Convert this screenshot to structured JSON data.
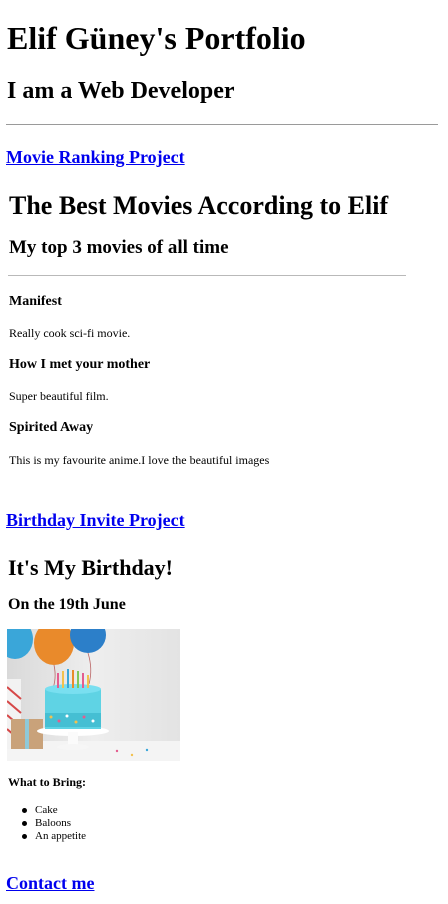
{
  "header": {
    "title": "Elif Güney's Portfolio",
    "subtitle": "I am a Web Developer"
  },
  "movie_section": {
    "link_text": "Movie Ranking Project",
    "title": "The Best Movies According to Elif",
    "subtitle": "My top 3 movies of all time",
    "movies": [
      {
        "name": "Manifest",
        "description": "Really cook sci-fi movie."
      },
      {
        "name": "How I met your mother",
        "description": "Super beautiful film."
      },
      {
        "name": "Spirited Away",
        "description": "This is my favourite anime.I love the beautiful images"
      }
    ]
  },
  "birthday_section": {
    "link_text": "Birthday Invite Project",
    "title": "It's My Birthday!",
    "date": "On the 19th June",
    "image": "birthday-cake-with-balloons",
    "bring_title": "What to Bring:",
    "bring_items": [
      "Cake",
      "Baloons",
      "An appetite"
    ]
  },
  "contact": {
    "link_text": "Contact me"
  }
}
